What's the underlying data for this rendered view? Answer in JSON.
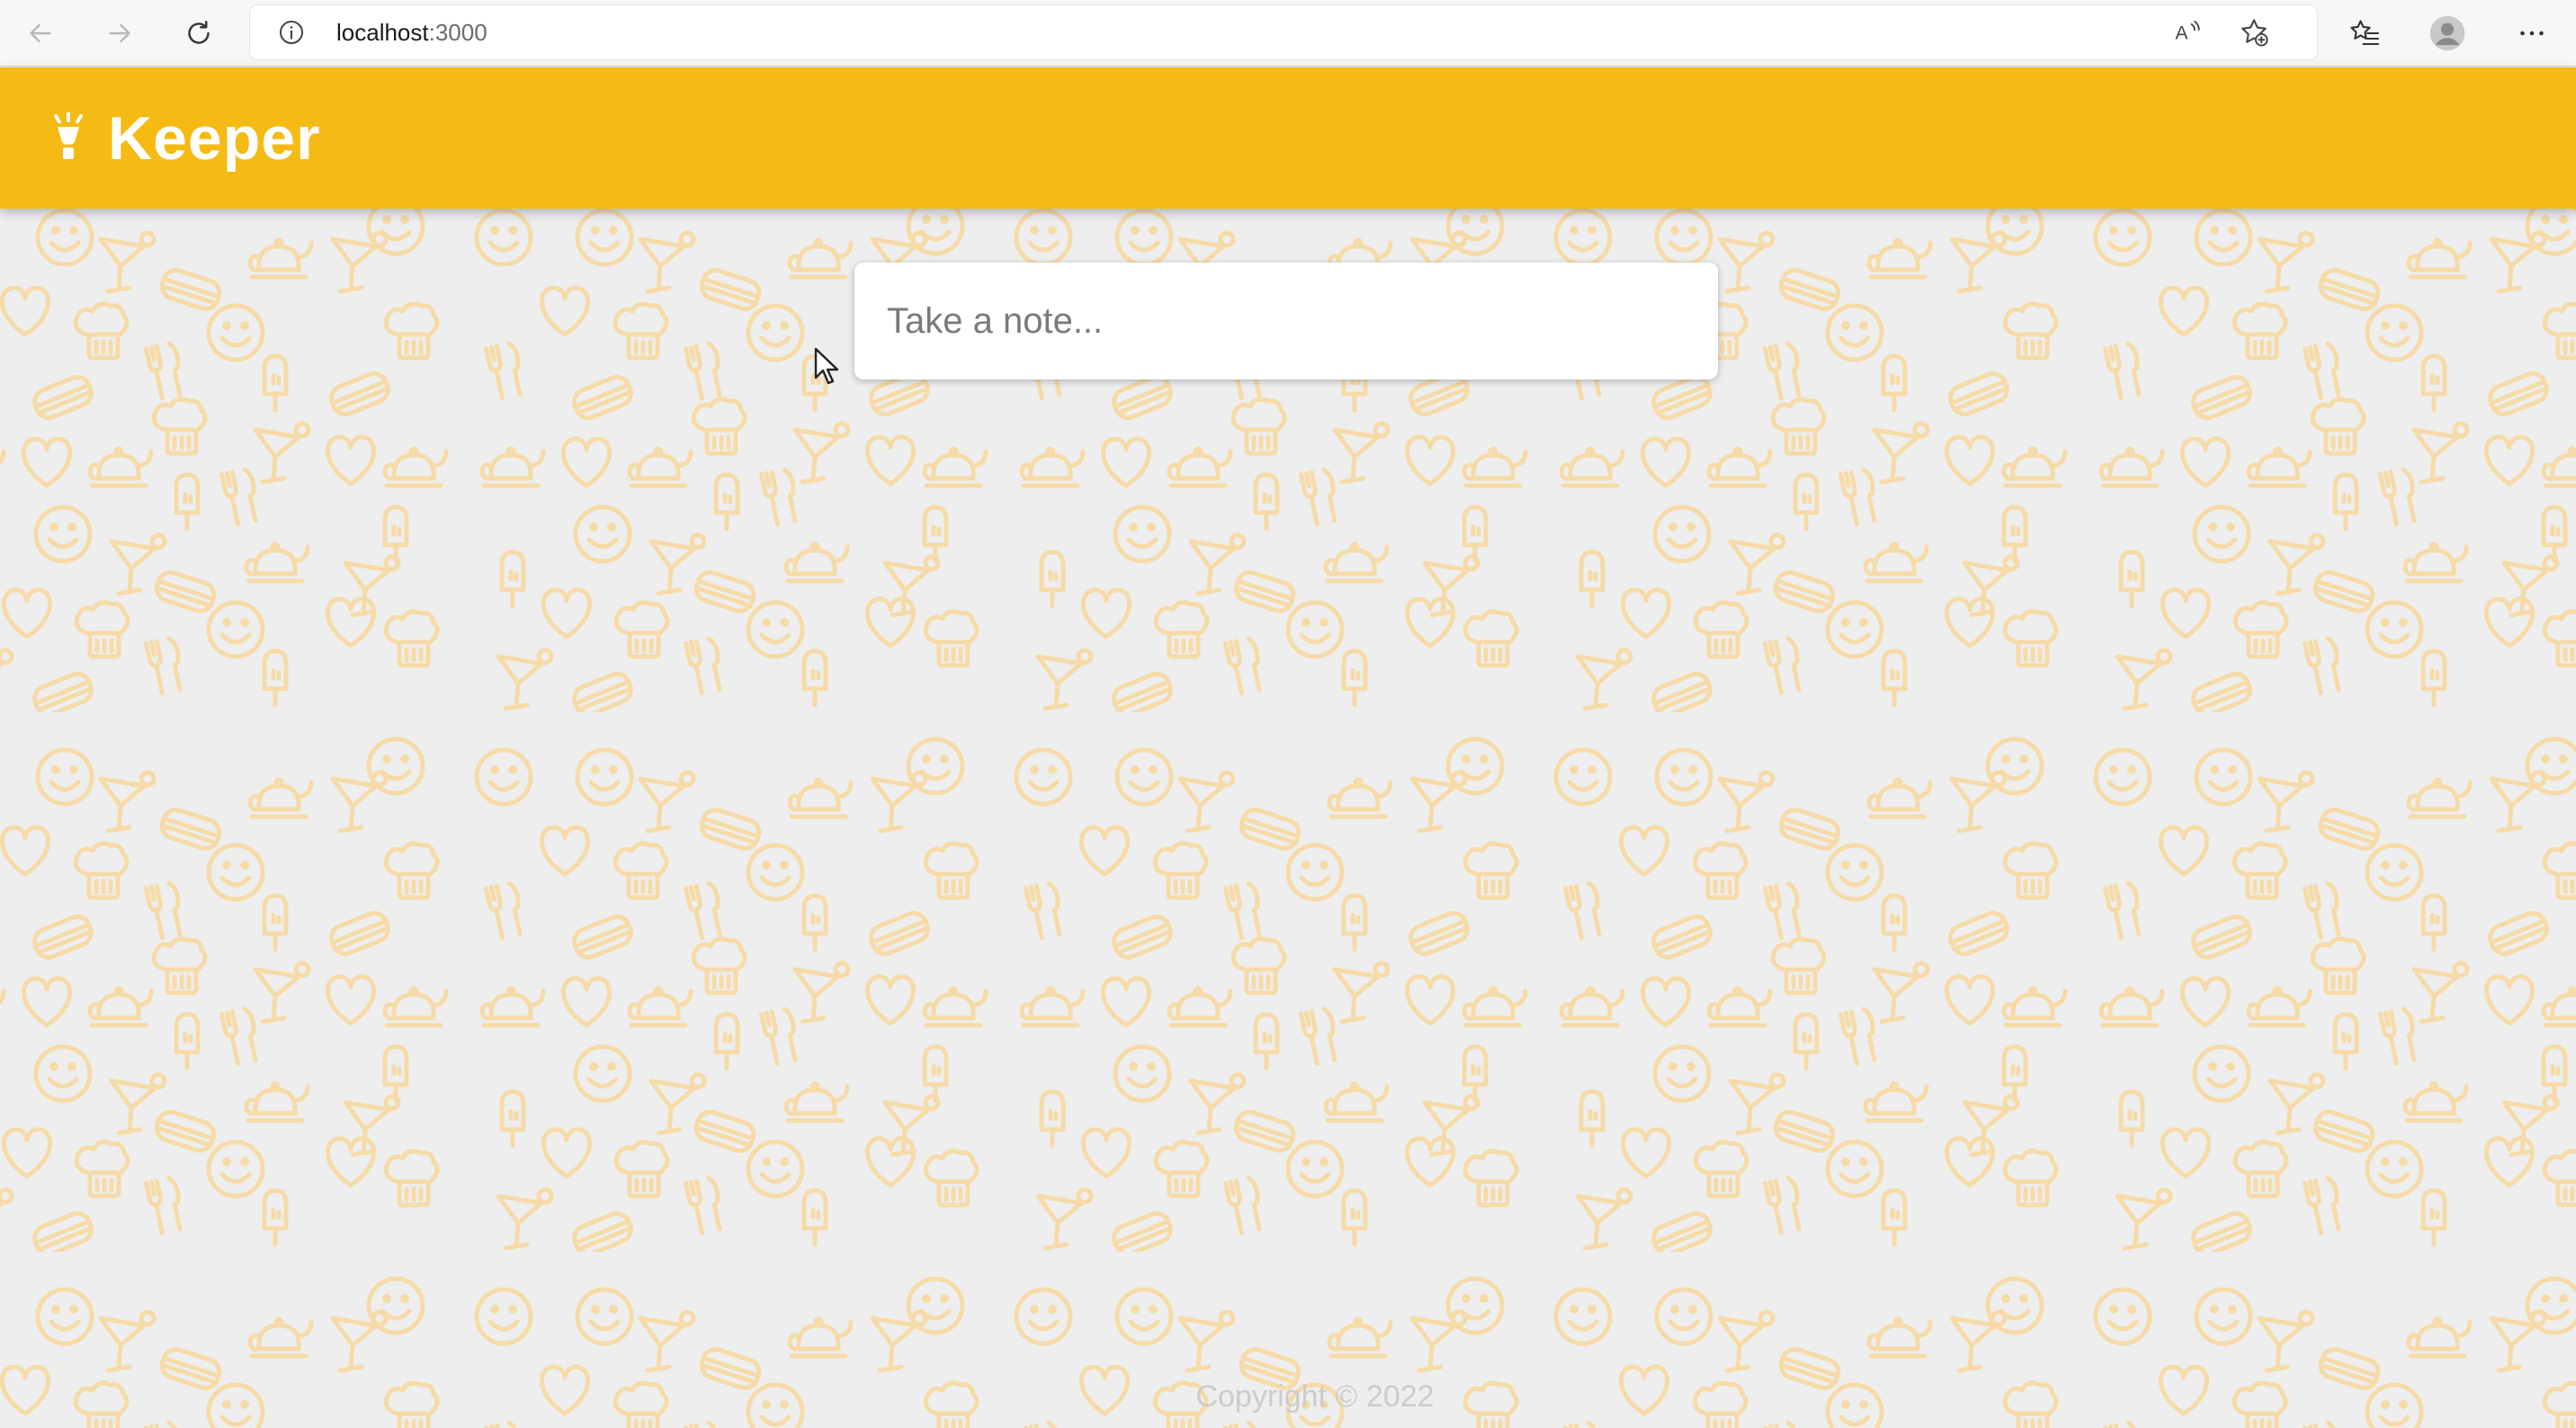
{
  "browser": {
    "url_host": "localhost",
    "url_port": ":3000",
    "icons": {
      "back": "back-arrow-icon",
      "forward": "forward-arrow-icon",
      "reload": "reload-icon",
      "info": "info-icon",
      "read_aloud": "read-aloud-icon",
      "add_favorite": "add-favorite-icon",
      "favorites": "favorites-icon",
      "profile": "profile-icon",
      "menu": "more-menu-icon"
    }
  },
  "app": {
    "title": "Keeper",
    "logo_icon": "lightbulb-icon",
    "colors": {
      "header": "#f5ba13",
      "background": "#eeeeee",
      "pattern": "#f6dba8"
    }
  },
  "note": {
    "placeholder": "Take a note..."
  },
  "footer": {
    "text": "Copyright © 2022"
  }
}
